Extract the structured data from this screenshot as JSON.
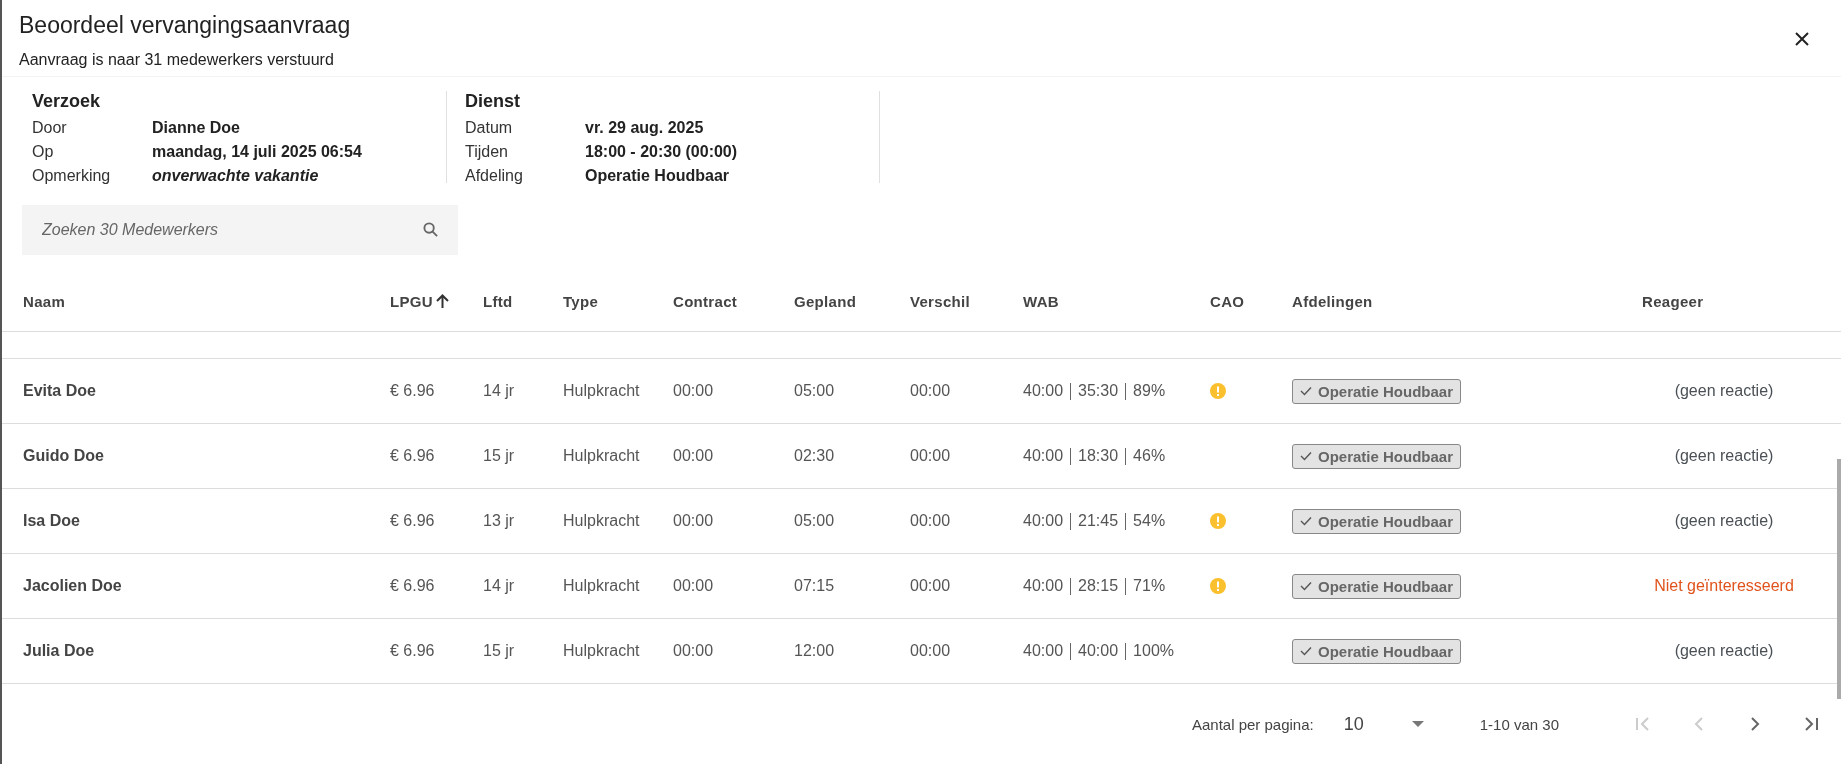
{
  "dialog": {
    "title": "Beoordeel vervangingsaanvraag",
    "subtitle": "Aanvraag is naar 31 medewerkers verstuurd"
  },
  "info_sections": [
    {
      "heading": "Verzoek",
      "fields": [
        {
          "label": "Door",
          "value": "Dianne Doe",
          "italic": false
        },
        {
          "label": "Op",
          "value": "maandag, 14 juli 2025 06:54",
          "italic": false
        },
        {
          "label": "Opmerking",
          "value": "onverwachte vakantie",
          "italic": true
        }
      ]
    },
    {
      "heading": "Dienst",
      "fields": [
        {
          "label": "Datum",
          "value": "vr. 29 aug. 2025",
          "italic": false
        },
        {
          "label": "Tijden",
          "value": "18:00 - 20:30 (00:00)",
          "italic": false
        },
        {
          "label": "Afdeling",
          "value": "Operatie Houdbaar",
          "italic": false
        }
      ]
    }
  ],
  "search": {
    "placeholder": "Zoeken 30 Medewerkers"
  },
  "table": {
    "columns": [
      {
        "label": "Naam",
        "sorted": false
      },
      {
        "label": "LPGU",
        "sorted": true
      },
      {
        "label": "Lftd",
        "sorted": false
      },
      {
        "label": "Type",
        "sorted": false
      },
      {
        "label": "Contract",
        "sorted": false
      },
      {
        "label": "Gepland",
        "sorted": false
      },
      {
        "label": "Verschil",
        "sorted": false
      },
      {
        "label": "WAB",
        "sorted": false
      },
      {
        "label": "CAO",
        "sorted": false
      },
      {
        "label": "Afdelingen",
        "sorted": false
      },
      {
        "label": "Reageer",
        "sorted": false
      }
    ],
    "rows": [
      {
        "name": "Evita Doe",
        "lpgu": "€ 6.96",
        "age": "14 jr",
        "type": "Hulpkracht",
        "contract": "00:00",
        "planned": "05:00",
        "difference": "00:00",
        "wab": [
          "40:00",
          "35:30",
          "89%"
        ],
        "cao_warning": true,
        "departments": [
          {
            "label": "Operatie Houdbaar",
            "checked": true
          }
        ],
        "response": {
          "text": "(geen reactie)",
          "kind": "none"
        }
      },
      {
        "name": "Guido Doe",
        "lpgu": "€ 6.96",
        "age": "15 jr",
        "type": "Hulpkracht",
        "contract": "00:00",
        "planned": "02:30",
        "difference": "00:00",
        "wab": [
          "40:00",
          "18:30",
          "46%"
        ],
        "cao_warning": false,
        "departments": [
          {
            "label": "Operatie Houdbaar",
            "checked": true
          }
        ],
        "response": {
          "text": "(geen reactie)",
          "kind": "none"
        }
      },
      {
        "name": "Isa Doe",
        "lpgu": "€ 6.96",
        "age": "13 jr",
        "type": "Hulpkracht",
        "contract": "00:00",
        "planned": "05:00",
        "difference": "00:00",
        "wab": [
          "40:00",
          "21:45",
          "54%"
        ],
        "cao_warning": true,
        "departments": [
          {
            "label": "Operatie Houdbaar",
            "checked": true
          }
        ],
        "response": {
          "text": "(geen reactie)",
          "kind": "none"
        }
      },
      {
        "name": "Jacolien Doe",
        "lpgu": "€ 6.96",
        "age": "14 jr",
        "type": "Hulpkracht",
        "contract": "00:00",
        "planned": "07:15",
        "difference": "00:00",
        "wab": [
          "40:00",
          "28:15",
          "71%"
        ],
        "cao_warning": true,
        "departments": [
          {
            "label": "Operatie Houdbaar",
            "checked": true
          }
        ],
        "response": {
          "text": "Niet geïnteresseerd",
          "kind": "declined"
        }
      },
      {
        "name": "Julia Doe",
        "lpgu": "€ 6.96",
        "age": "15 jr",
        "type": "Hulpkracht",
        "contract": "00:00",
        "planned": "12:00",
        "difference": "00:00",
        "wab": [
          "40:00",
          "40:00",
          "100%"
        ],
        "cao_warning": false,
        "departments": [
          {
            "label": "Operatie Houdbaar",
            "checked": true
          }
        ],
        "response": {
          "text": "(geen reactie)",
          "kind": "none"
        }
      }
    ]
  },
  "pagination": {
    "label": "Aantal per pagina:",
    "page_size": "10",
    "range": "1-10 van 30",
    "first_disabled": true,
    "prev_disabled": true,
    "next_disabled": false,
    "last_disabled": false
  }
}
